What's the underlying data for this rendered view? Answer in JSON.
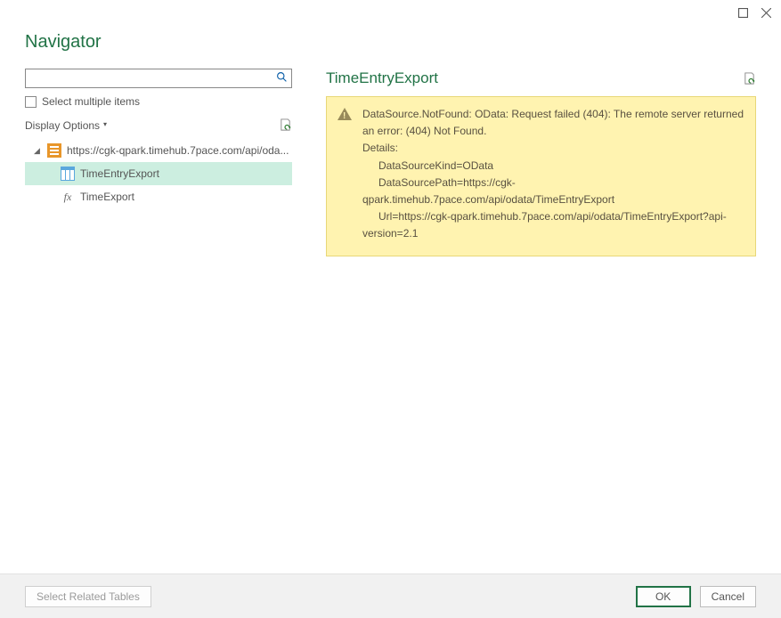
{
  "window": {
    "title": "Navigator"
  },
  "left": {
    "search_placeholder": "",
    "select_multiple_label": "Select multiple items",
    "display_options_label": "Display Options",
    "root_label": "https://cgk-qpark.timehub.7pace.com/api/oda...",
    "items": [
      {
        "label": "TimeEntryExport",
        "icon": "table",
        "selected": true
      },
      {
        "label": "TimeExport",
        "icon": "fx",
        "selected": false
      }
    ]
  },
  "preview": {
    "title": "TimeEntryExport",
    "error": {
      "headline": "DataSource.NotFound: OData: Request failed (404): The remote server returned an error: (404) Not Found.",
      "details_label": "Details:",
      "kind_line": "DataSourceKind=OData",
      "path_line_1": "DataSourcePath=https://cgk-",
      "path_line_2": "qpark.timehub.7pace.com/api/odata/TimeEntryExport",
      "url_line_1": "Url=https://cgk-qpark.timehub.7pace.com/api/odata/TimeEntryExport?api-",
      "url_line_2": "version=2.1"
    }
  },
  "footer": {
    "select_related": "Select Related Tables",
    "ok": "OK",
    "cancel": "Cancel"
  }
}
